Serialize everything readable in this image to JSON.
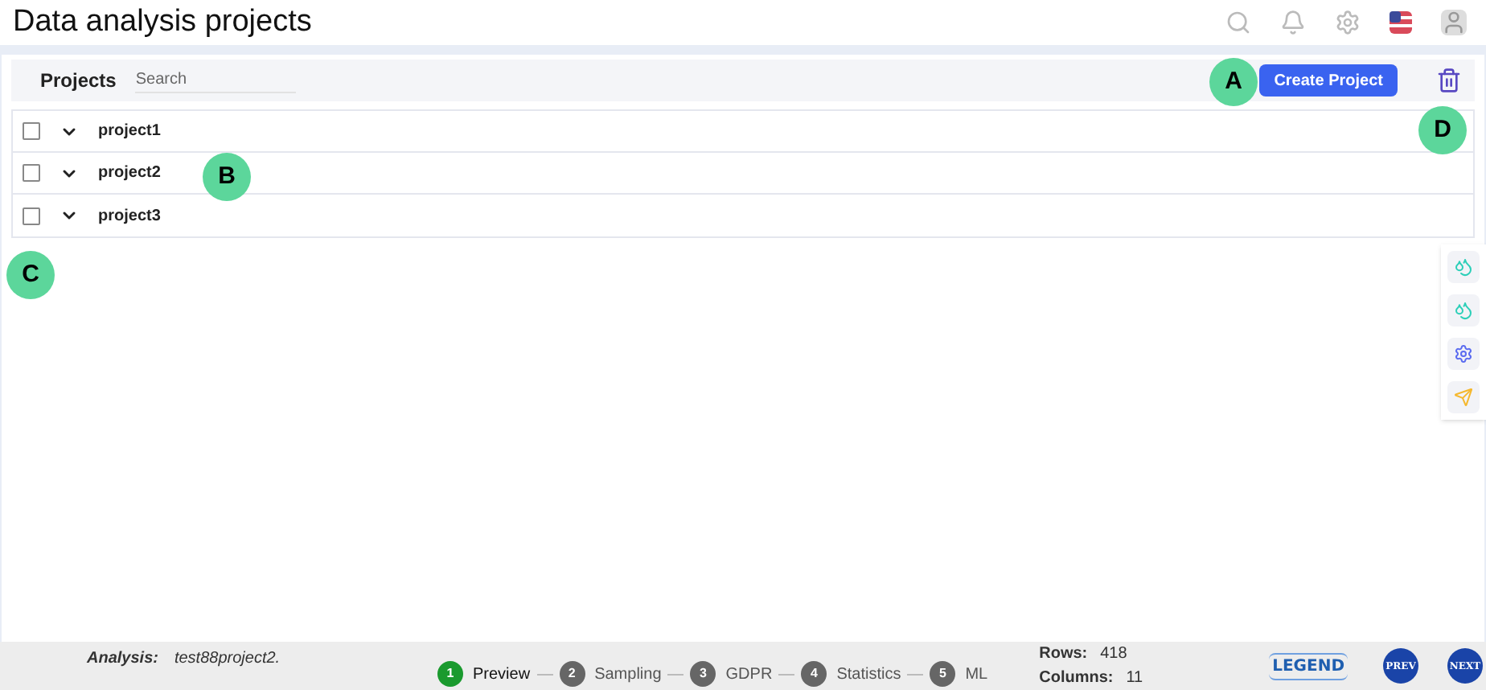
{
  "header": {
    "title": "Data analysis projects"
  },
  "toolbar": {
    "label": "Projects",
    "search": {
      "placeholder": "Search"
    },
    "create_button": "Create Project"
  },
  "projects": [
    {
      "name": "project1",
      "checked": false
    },
    {
      "name": "project2",
      "checked": false
    },
    {
      "name": "project3",
      "checked": false
    }
  ],
  "callouts": [
    {
      "label": "A"
    },
    {
      "label": "B"
    },
    {
      "label": "C"
    },
    {
      "label": "D"
    }
  ],
  "side_tools": [
    {
      "kind": "drops",
      "color": "#2ccfb8"
    },
    {
      "kind": "drops",
      "color": "#2ccfb8"
    },
    {
      "kind": "gear",
      "color": "#5b6cf0"
    },
    {
      "kind": "send",
      "color": "#f5b82e"
    }
  ],
  "footer": {
    "analysis_label": "Analysis:",
    "analysis_value": "test88project2.",
    "steps": [
      {
        "number": "1",
        "label": "Preview",
        "selected": true
      },
      {
        "number": "2",
        "label": "Sampling",
        "selected": false
      },
      {
        "number": "3",
        "label": "GDPR",
        "selected": false
      },
      {
        "number": "4",
        "label": "Statistics",
        "selected": false
      },
      {
        "number": "5",
        "label": "ML",
        "selected": false
      }
    ],
    "rows_label": "Rows:",
    "rows_value": "418",
    "columns_label": "Columns:",
    "columns_value": "11",
    "legend": "LEGEND",
    "prev": "PREV",
    "next": "NEXT"
  }
}
